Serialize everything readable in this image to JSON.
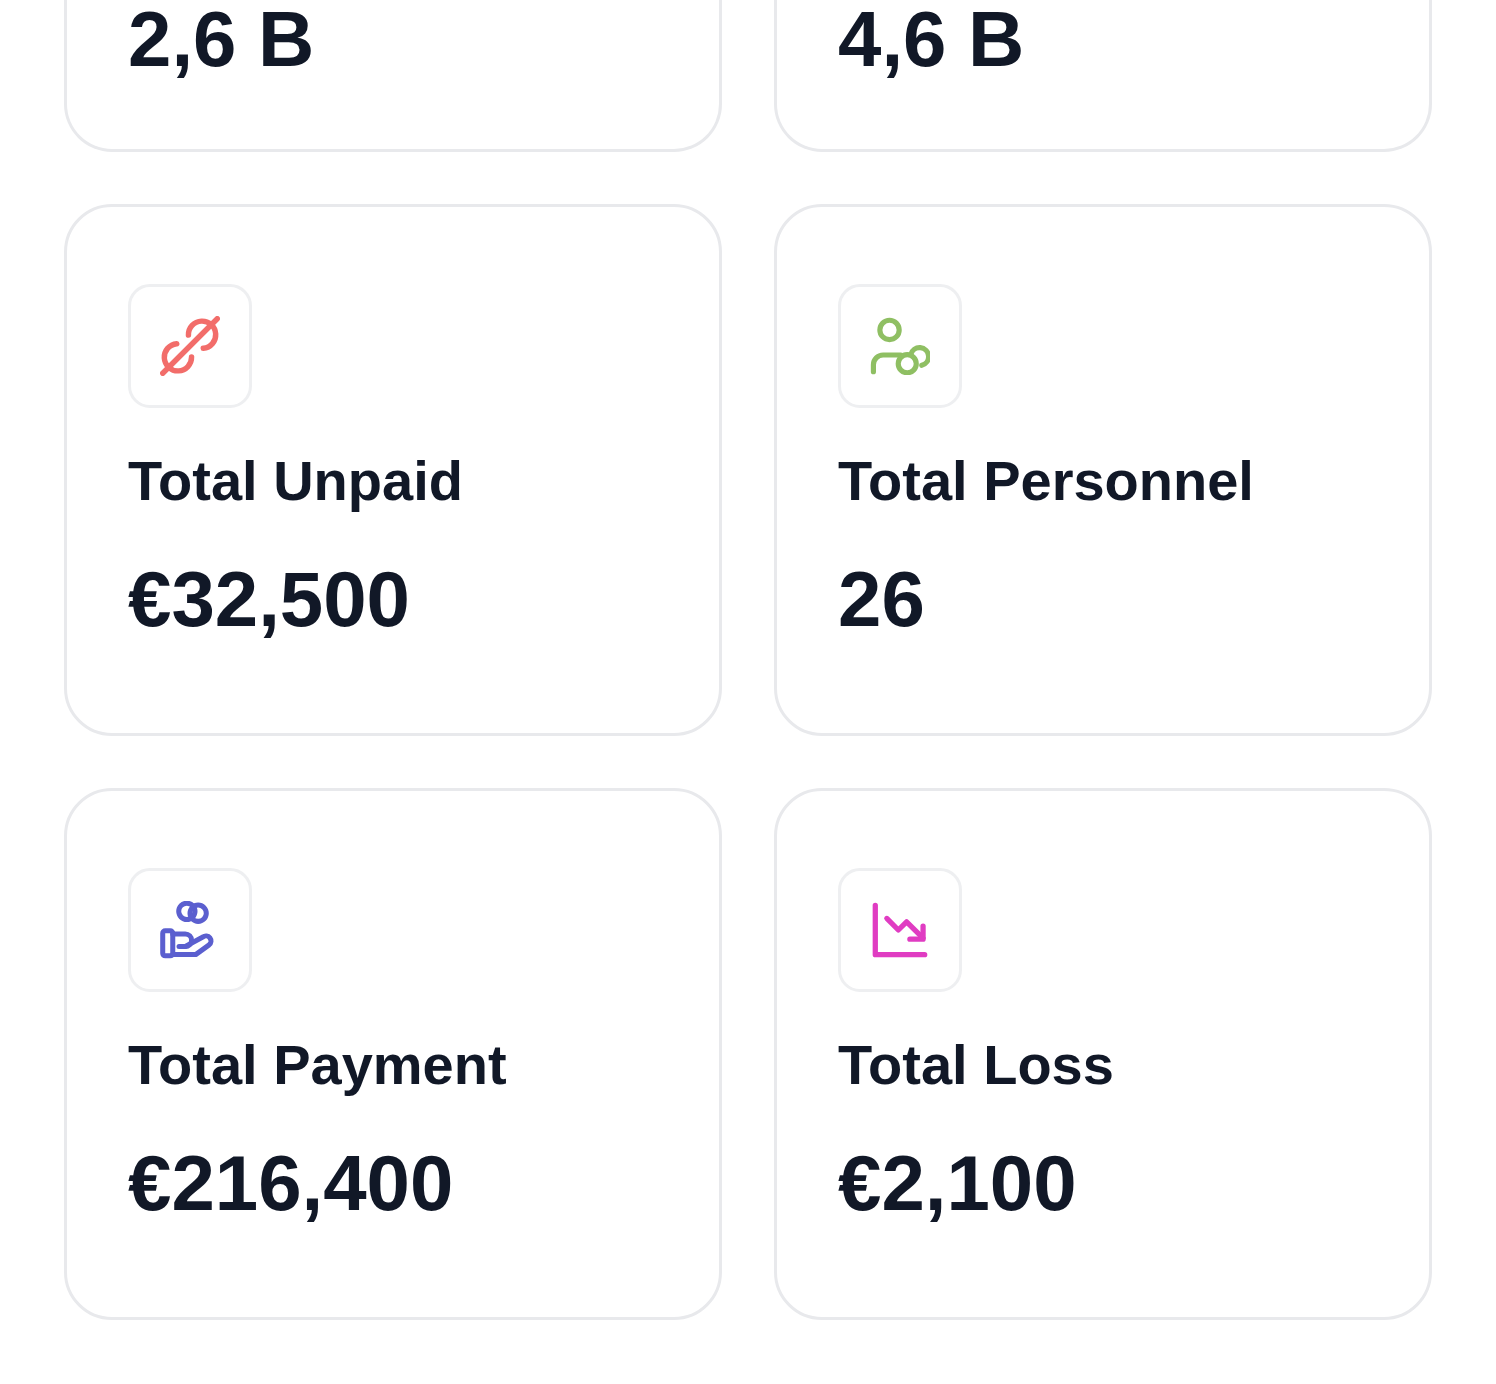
{
  "top_cards": [
    {
      "value": "2,6 B"
    },
    {
      "value": "4,6 B"
    }
  ],
  "cards": [
    {
      "title": "Total Unpaid",
      "value": "€32,500",
      "color": "#f26d6a"
    },
    {
      "title": "Total Personnel",
      "value": "26",
      "color": "#8fbf63"
    },
    {
      "title": "Total Payment",
      "value": "€216,400",
      "color": "#5b5fcf"
    },
    {
      "title": "Total Loss",
      "value": "€2,100",
      "color": "#e03cc2"
    }
  ]
}
